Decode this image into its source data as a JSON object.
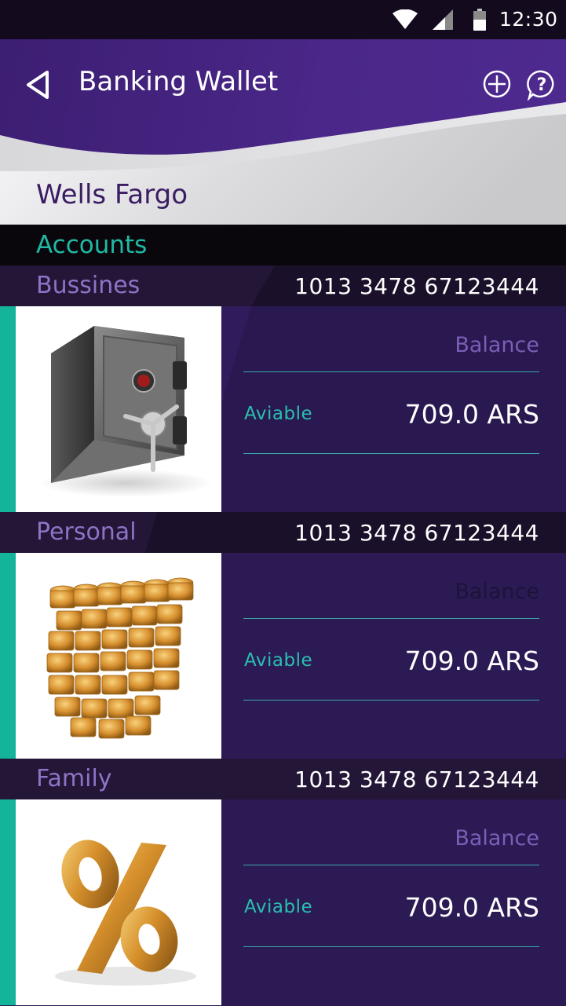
{
  "status_bar": {
    "time": "12:30",
    "icons": [
      "wifi-icon",
      "signal-icon",
      "battery-icon"
    ]
  },
  "header": {
    "title": "Banking Wallet",
    "back_icon": "back-triangle-icon",
    "actions": [
      "add-circle-icon",
      "help-icon"
    ]
  },
  "bank": {
    "name": "Wells Fargo"
  },
  "section": {
    "title": "Accounts"
  },
  "accounts": [
    {
      "name": "Bussines",
      "number": "1013 3478 67123444",
      "balance_label": "Balance",
      "available_label": "Aviable",
      "available_value": "709.0 ARS",
      "image": "safe-image"
    },
    {
      "name": "Personal",
      "number": "1013 3478 67123444",
      "balance_label": "Balance",
      "available_label": "Aviable",
      "available_value": "709.0 ARS",
      "image": "coin-stacks-image"
    },
    {
      "name": "Family",
      "number": "1013 3478 67123444",
      "balance_label": "Balance",
      "available_label": "Aviable",
      "available_value": "709.0 ARS",
      "image": "percent-symbol-image"
    }
  ],
  "colors": {
    "accent_teal": "#14b49b",
    "brand_purple": "#4a2788",
    "account_name": "#8e73c6"
  }
}
